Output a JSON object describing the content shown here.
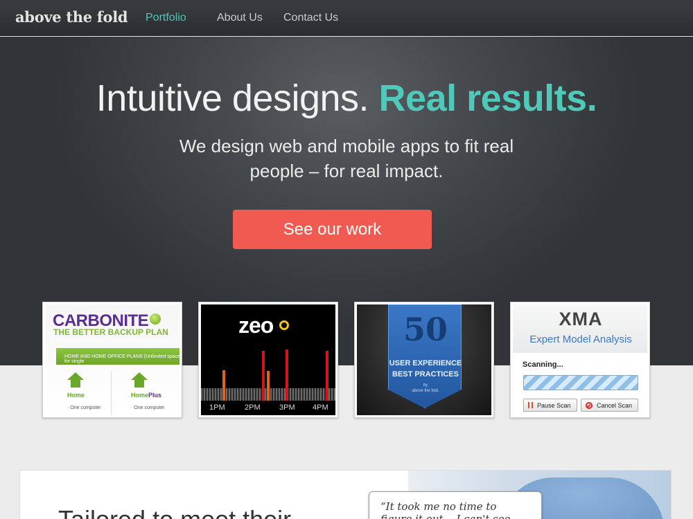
{
  "nav": {
    "logo": "above the fold",
    "links": [
      {
        "label": "Portfolio",
        "active": true
      },
      {
        "label": "About Us",
        "active": false
      },
      {
        "label": "Contact Us",
        "active": false
      }
    ]
  },
  "hero": {
    "title_plain": "Intuitive designs.",
    "title_accent": "Real results.",
    "subtitle": "We design web and mobile apps to fit real people – for real impact.",
    "cta": "See our work"
  },
  "portfolio": {
    "carbonite": {
      "logo": "CARBONITE",
      "tagline": "THE BETTER BACKUP PLAN",
      "bar_text": "HOME AND HOME OFFICE PLANS (Unlimited space for single",
      "plans": [
        {
          "name_a": "Home",
          "name_b": "",
          "item": "· One computer"
        },
        {
          "name_a": "Home",
          "name_b": "Plus",
          "item": "· One computer"
        }
      ]
    },
    "zeo": {
      "logo": "zeo",
      "axis": [
        "1PM",
        "2PM",
        "3PM",
        "4PM"
      ]
    },
    "ux50": {
      "number": "50",
      "line1": "USER EXPERIENCE",
      "line2": "BEST PRACTICES",
      "by": "by",
      "author": "above the fold."
    },
    "xma": {
      "title": "XMA",
      "subtitle": "Expert Model Analysis",
      "status": "Scanning...",
      "pause_label": "Pause Scan",
      "cancel_label": "Cancel Scan"
    }
  },
  "lower": {
    "heading": "Tailored to meet their",
    "quote": "“It took me no time to figure it out... I can't see anybody"
  },
  "colors": {
    "accent": "#4fc9b9",
    "cta": "#f15a50",
    "nav_bg": "#2b2e31"
  }
}
